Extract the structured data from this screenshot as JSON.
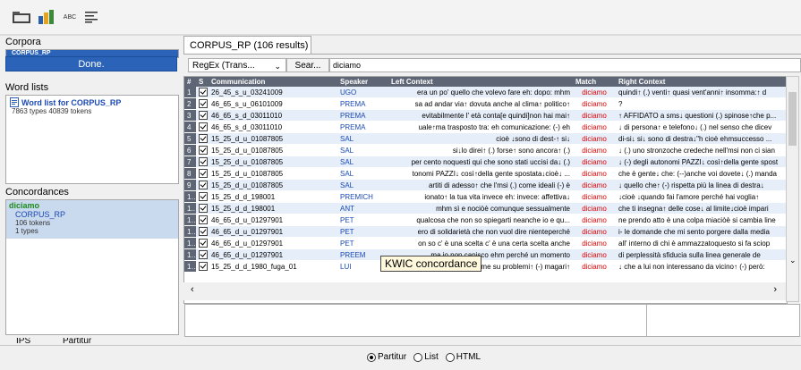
{
  "toolbar": {
    "icons": [
      "open-folder-icon",
      "bar-chart-icon",
      "abc-text-icon",
      "list-options-icon"
    ],
    "abc_label": "ABC"
  },
  "left": {
    "corpora_title": "Corpora",
    "corpora_item": "CORPUS_RP",
    "done_label": "Done.",
    "wordlists_title": "Word lists",
    "wordlist_name": "Word list for CORPUS_RP",
    "wordlist_stats": "7863 types   40839 tokens",
    "concordances_title": "Concordances",
    "conc_query": "diciamo",
    "conc_corpus": "CORPUS_RP",
    "conc_tokens": "106 tokens",
    "conc_types": "1 types",
    "bottom_tabs": [
      "IPS",
      "Partitur"
    ]
  },
  "right": {
    "tab_title": "CORPUS_RP (106 results)",
    "regex_label": "RegEx (Trans...",
    "search_label": "Sear...",
    "search_value": "diciamo",
    "columns": [
      "#",
      "S",
      "Communication",
      "Speaker",
      "Left Context",
      "Match",
      "Right Context"
    ],
    "rows": [
      {
        "n": "1",
        "comm": "26_45_s_u_03241009",
        "spk": "UGO",
        "left": "era  un po'  quello che volevo fare eh: dopo: mhm",
        "match": "diciamo",
        "right": "quindi↑ (.) venti↑ quasi  vent'anni↑ insomma:↑  d"
      },
      {
        "n": "2",
        "comm": "46_65_s_u_06101009",
        "spk": "PREMA",
        "left": "sa ad andar via↑ dovuta anche al clima↑ politico↑",
        "match": "diciamo",
        "right": "?"
      },
      {
        "n": "3",
        "comm": "46_65_s_d_03011010",
        "spk": "PREMA",
        "left": "evitabilmente l' età  conta[e quindi]non hai mai↑",
        "match": "diciamo",
        "right": "↑ AFFIDATO a sms↓ questioni (.) spinose↑che p..."
      },
      {
        "n": "4",
        "comm": "46_65_s_d_03011010",
        "spk": "PREMA",
        "left": "uale↑ma trasposto tra: eh comunicazione: (-)  eh",
        "match": "diciamo",
        "right": "↓  di persona↑ e telefono↓ (.) nel senso che dicev"
      },
      {
        "n": "5",
        "comm": "15_25_d_u_01087805",
        "spk": "SAL",
        "left": "cioè ↓sono di dest-↑ si↓",
        "match": "diciamo",
        "right": "di-si↓ si↓ sono di destra↓\"h cioè ehmsuccesso ..."
      },
      {
        "n": "6",
        "comm": "15_25_d_u_01087805",
        "spk": "SAL",
        "left": "si↓lo direi↑ (.) forse↑ sono ancora↑ (.)",
        "match": "diciamo",
        "right": "↓ (.) uno stronzoche credeche nell'msi non ci sian"
      },
      {
        "n": "7",
        "comm": "15_25_d_u_01087805",
        "spk": "SAL",
        "left": "per cento noquesti qui che sono stati uccisi da↓ (.)",
        "match": "diciamo",
        "right": "↓ (-) degli autonomi PAZZI↓ così↑della gente spost"
      },
      {
        "n": "8",
        "comm": "15_25_d_u_01087805",
        "spk": "SAL",
        "left": "tonomi PAZZI↓ così↑della gente spostata↓cioè↓ ...",
        "match": "diciamo",
        "right": "che è gente↓ che: (--)anche voi dovete↓ (.) manda"
      },
      {
        "n": "9",
        "comm": "15_25_d_u_01087805",
        "spk": "SAL",
        "left": "artiti di adesso↑ che l'msi (.) come ideali (-) è",
        "match": "diciamo",
        "right": "↓ quello che↑ (-) rispetta più la linea di destra↓"
      },
      {
        "n": "10",
        "comm": "15_25_d_d_198001",
        "spk": "PREMICH",
        "left": "ionato↑ la tua vita invece eh: invece: affettiva↓",
        "match": "diciamo",
        "right": "↓cioè ↓quando fai l'amore perché hai voglia↑"
      },
      {
        "n": "11",
        "comm": "15_25_d_d_198001",
        "spk": "ANT",
        "left": "mhm sì e nociòè comunque sessualmente",
        "match": "diciamo",
        "right": "che ti insegna↑ delle cose↓ al limite↓cioè impari"
      },
      {
        "n": "12",
        "comm": "46_65_d_u_01297901",
        "spk": "PET",
        "left": "qualcosa che non so spiegarti neanche io e qu...",
        "match": "diciamo",
        "right": "ne prendo atto è una colpa miaciòè si cambia line"
      },
      {
        "n": "13",
        "comm": "46_65_d_u_01297901",
        "spk": "PET",
        "left": "ero di solidarietà che non vuol dire nienteperché",
        "match": "diciamo",
        "right": "i-  le domande che mi sento porgere dalla media"
      },
      {
        "n": "14",
        "comm": "46_65_d_u_01297901",
        "spk": "PET",
        "left": "on so c' è una scelta c' è una certa scelta anche",
        "match": "diciamo",
        "right": "all' interno di chi è ammazzatoquesto si fa sciop"
      },
      {
        "n": "15",
        "comm": "46_65_d_u_01297901",
        "spk": "PREEM",
        "left": "ma io non capisco ehm perché un momento",
        "match": "diciamo",
        "right": "di perplessità sfiducia sulla linea generale de"
      },
      {
        "n": "16",
        "comm": "15_25_d_d_1980_fuga_01",
        "spk": "LUI",
        "left": "tersi a discutere con me su problemi↑ (-) magari↑",
        "match": "diciamo",
        "right": "↓ che a lui non interessano da vicino↑ (-) però:"
      }
    ],
    "tooltip": "KWIC concordance"
  },
  "footer": {
    "options": [
      "Partitur",
      "List",
      "HTML"
    ],
    "selected": "Partitur"
  }
}
